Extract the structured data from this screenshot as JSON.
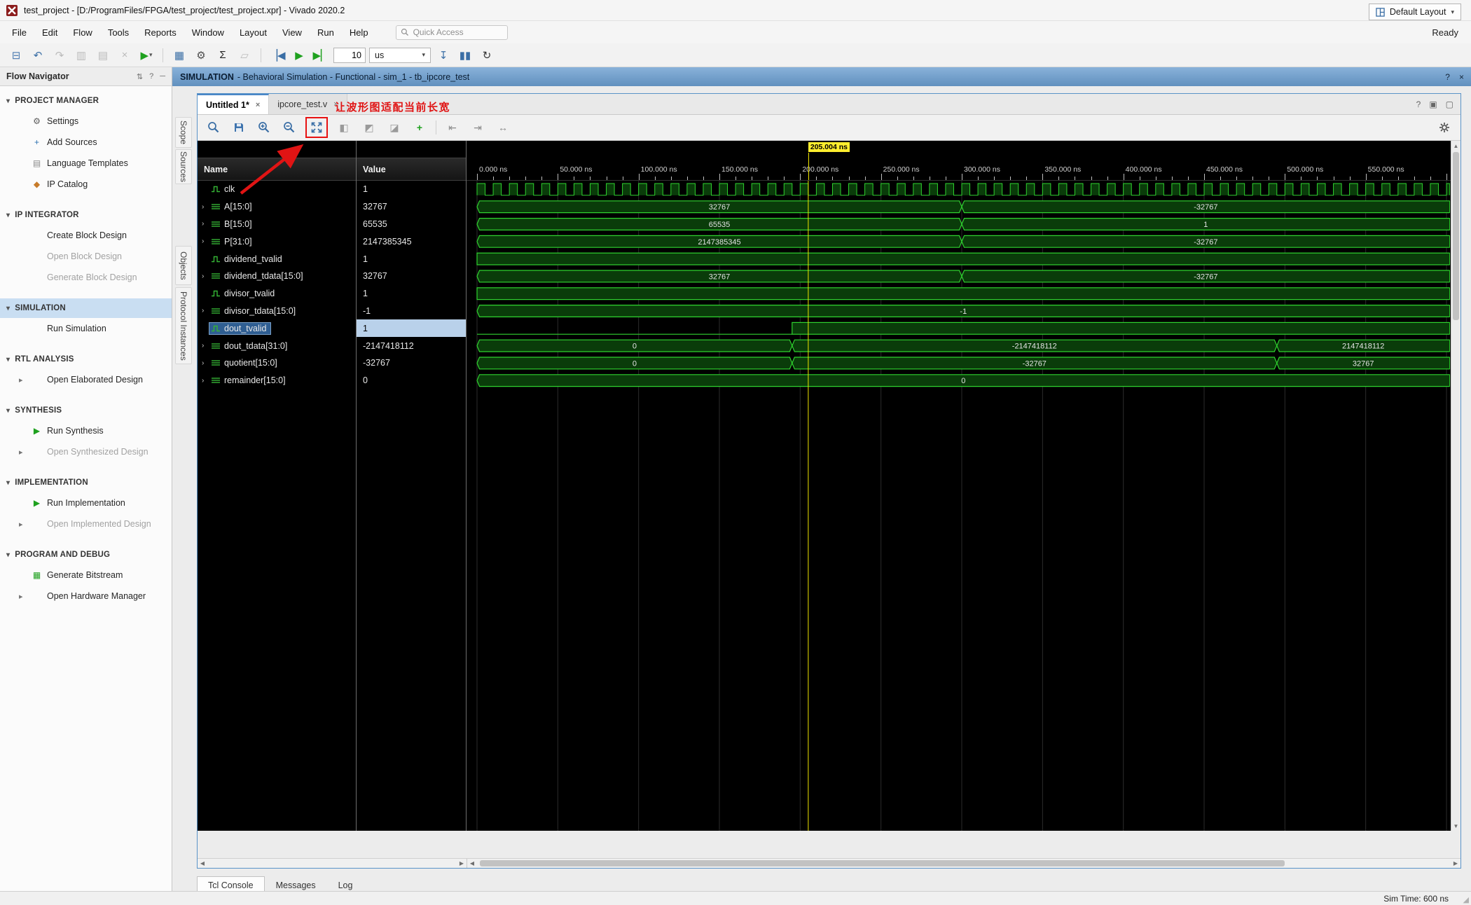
{
  "window": {
    "title": "test_project - [D:/ProgramFiles/FPGA/test_project/test_project.xpr] - Vivado 2020.2",
    "ready": "Ready"
  },
  "menu": {
    "items": [
      "File",
      "Edit",
      "Flow",
      "Tools",
      "Reports",
      "Window",
      "Layout",
      "View",
      "Run",
      "Help"
    ],
    "quick_access_placeholder": "Quick Access"
  },
  "toolbar": {
    "icons_before": [
      "open",
      "undo",
      "redo",
      "copy",
      "paste",
      "delete",
      "run",
      "sep",
      "debug",
      "settings",
      "sum",
      "edit",
      "sep",
      "restart",
      "run-all",
      "run-for"
    ],
    "run_time_value": "10",
    "run_time_unit": "us",
    "icons_after": [
      "step",
      "pause",
      "relaunch"
    ],
    "layout_select": "Default Layout"
  },
  "context_bar": {
    "title": "SIMULATION",
    "subtitle": "- Behavioral Simulation - Functional - sim_1 - tb_ipcore_test"
  },
  "flow_navigator": {
    "title": "Flow Navigator",
    "sections": [
      {
        "label": "PROJECT MANAGER",
        "selected": false,
        "items": [
          {
            "label": "Settings",
            "icon": "gear"
          },
          {
            "label": "Add Sources",
            "icon": "add"
          },
          {
            "label": "Language Templates",
            "icon": "template"
          },
          {
            "label": "IP Catalog",
            "icon": "ip"
          }
        ]
      },
      {
        "label": "IP INTEGRATOR",
        "selected": false,
        "items": [
          {
            "label": "Create Block Design"
          },
          {
            "label": "Open Block Design",
            "disabled": true
          },
          {
            "label": "Generate Block Design",
            "disabled": true
          }
        ]
      },
      {
        "label": "SIMULATION",
        "selected": true,
        "items": [
          {
            "label": "Run Simulation"
          }
        ]
      },
      {
        "label": "RTL ANALYSIS",
        "selected": false,
        "items": [
          {
            "label": "Open Elaborated Design",
            "expand": true
          }
        ]
      },
      {
        "label": "SYNTHESIS",
        "selected": false,
        "items": [
          {
            "label": "Run Synthesis",
            "icon": "play"
          },
          {
            "label": "Open Synthesized Design",
            "expand": true,
            "disabled": true
          }
        ]
      },
      {
        "label": "IMPLEMENTATION",
        "selected": false,
        "items": [
          {
            "label": "Run Implementation",
            "icon": "play"
          },
          {
            "label": "Open Implemented Design",
            "expand": true,
            "disabled": true
          }
        ]
      },
      {
        "label": "PROGRAM AND DEBUG",
        "selected": false,
        "items": [
          {
            "label": "Generate Bitstream",
            "icon": "bitstream"
          },
          {
            "label": "Open Hardware Manager",
            "expand": true
          }
        ]
      }
    ]
  },
  "workspace": {
    "tabs": [
      {
        "label": "Untitled 1*",
        "active": true
      },
      {
        "label": "ipcore_test.v",
        "active": false
      }
    ],
    "side_tabs": [
      "Scope",
      "Sources",
      "Objects",
      "Protocol Instances"
    ],
    "wave_toolbar_icons": [
      "search",
      "save",
      "zoom-in",
      "zoom-out",
      "zoom-fit",
      "zoom-range",
      "prev-transition",
      "next-transition",
      "add-marker",
      "sep",
      "goto-start",
      "goto-end",
      "swap-cursor"
    ],
    "annotation": {
      "text": "让波形图适配当前长宽",
      "color": "#e01414"
    },
    "table": {
      "name_header": "Name",
      "value_header": "Value"
    }
  },
  "wave": {
    "cursor_ns": 205.004,
    "cursor_label": "205.004 ns",
    "time_range_ns": [
      0,
      602
    ],
    "major_tick_ns": 50,
    "tick_labels": [
      "0.000 ns",
      "50.000 ns",
      "100.000 ns",
      "150.000 ns",
      "200.000 ns",
      "250.000 ns",
      "300.000 ns",
      "350.000 ns",
      "400.000 ns",
      "450.000 ns",
      "500.000 ns",
      "550.000 ns"
    ],
    "colors": {
      "wave_green": "#2fd32f",
      "wave_fill": "#0a3c0a",
      "cursor_yellow": "#f0e500",
      "grid": "#2c2c2c"
    },
    "signals": [
      {
        "name": "clk",
        "value": "1",
        "kind": "clock",
        "period_ns": 10,
        "expandable": false,
        "selected": false
      },
      {
        "name": "A[15:0]",
        "value": "32767",
        "kind": "bus",
        "expandable": true,
        "selected": false,
        "segments": [
          {
            "t": 0,
            "label": "32767"
          },
          {
            "t": 300,
            "label": "-32767"
          }
        ]
      },
      {
        "name": "B[15:0]",
        "value": "65535",
        "kind": "bus",
        "expandable": true,
        "selected": false,
        "segments": [
          {
            "t": 0,
            "label": "65535"
          },
          {
            "t": 300,
            "label": "1"
          }
        ]
      },
      {
        "name": "P[31:0]",
        "value": "2147385345",
        "kind": "bus",
        "expandable": true,
        "selected": false,
        "segments": [
          {
            "t": 0,
            "label": "2147385345"
          },
          {
            "t": 300,
            "label": "-32767"
          }
        ]
      },
      {
        "name": "dividend_tvalid",
        "value": "1",
        "kind": "bit",
        "expandable": false,
        "selected": false,
        "segments": [
          {
            "t": 0,
            "level": 1
          }
        ]
      },
      {
        "name": "dividend_tdata[15:0]",
        "value": "32767",
        "kind": "bus",
        "expandable": true,
        "selected": false,
        "segments": [
          {
            "t": 0,
            "label": "32767"
          },
          {
            "t": 300,
            "label": "-32767"
          }
        ]
      },
      {
        "name": "divisor_tvalid",
        "value": "1",
        "kind": "bit",
        "expandable": false,
        "selected": false,
        "segments": [
          {
            "t": 0,
            "level": 1
          }
        ]
      },
      {
        "name": "divisor_tdata[15:0]",
        "value": "-1",
        "kind": "bus",
        "expandable": true,
        "selected": false,
        "segments": [
          {
            "t": 0,
            "label": "-1"
          }
        ]
      },
      {
        "name": "dout_tvalid",
        "value": "1",
        "kind": "bit",
        "expandable": false,
        "selected": true,
        "segments": [
          {
            "t": 0,
            "level": 0
          },
          {
            "t": 195,
            "level": 1
          }
        ]
      },
      {
        "name": "dout_tdata[31:0]",
        "value": "-2147418112",
        "kind": "bus",
        "expandable": true,
        "selected": false,
        "segments": [
          {
            "t": 0,
            "label": "0"
          },
          {
            "t": 195,
            "label": "-2147418112"
          },
          {
            "t": 495,
            "label": "2147418112"
          }
        ]
      },
      {
        "name": "quotient[15:0]",
        "value": "-32767",
        "kind": "bus",
        "expandable": true,
        "selected": false,
        "segments": [
          {
            "t": 0,
            "label": "0"
          },
          {
            "t": 195,
            "label": "-32767"
          },
          {
            "t": 495,
            "label": "32767"
          }
        ]
      },
      {
        "name": "remainder[15:0]",
        "value": "0",
        "kind": "bus",
        "expandable": true,
        "selected": false,
        "segments": [
          {
            "t": 0,
            "label": "0"
          }
        ]
      }
    ]
  },
  "console": {
    "tabs": [
      "Tcl Console",
      "Messages",
      "Log"
    ]
  },
  "status_bar": {
    "sim_time": "Sim Time: 600 ns"
  }
}
